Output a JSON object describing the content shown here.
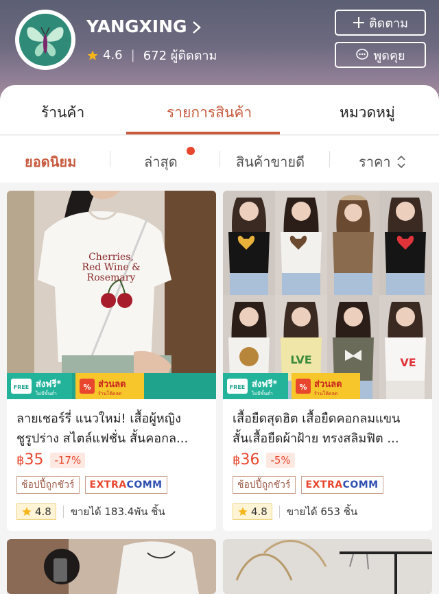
{
  "store": {
    "name": "YANGXING",
    "rating": "4.6",
    "followers": "672 ผู้ติดตาม",
    "follow_label": "ติดตาม",
    "chat_label": "พูดคุย"
  },
  "tabs": [
    {
      "label": "ร้านค้า"
    },
    {
      "label": "รายการสินค้า",
      "active": true
    },
    {
      "label": "หมวดหมู่"
    }
  ],
  "sort": [
    {
      "label": "ยอดนิยม",
      "active": true
    },
    {
      "label": "ล่าสุด"
    },
    {
      "label": "สินค้าขายดี"
    },
    {
      "label": "ราคา"
    }
  ],
  "banner": {
    "free_ship": "ส่งฟรี*",
    "free_ship_sub": "ไม่มีขั้นต่ำ",
    "discount": "ส่วนลด",
    "discount_sub": "ร้านโค้ดลด"
  },
  "products": [
    {
      "title_line1": "ลายเชอร์รี่ แนวใหม่! เสื้อผู้หญิง",
      "title_line2": "ชูรูปร่าง สไตล์แฟชั่น สั้นคอกล...",
      "currency": "฿",
      "price": "35",
      "discount": "-17%",
      "badge": "ช้อปปี้ถูกชัวร์",
      "extra1": "EXTRA",
      "extra2": "COMM",
      "rating": "4.8",
      "sold": "ขายได้ 183.4พัน ชิ้น",
      "shirt_text": [
        "Cherries,",
        "Red Wine &",
        "Rosemary"
      ]
    },
    {
      "title_line1": "เสื้อยืดสุดฮิต เสื้อยืดคอกลมแขน",
      "title_line2": "สั้นเสื้อยืดผ้าฝ้าย ทรงสลิมฟิต ...",
      "currency": "฿",
      "price": "36",
      "discount": "-5%",
      "badge": "ช้อปปี้ถูกชัวร์",
      "extra1": "EXTRA",
      "extra2": "COMM",
      "rating": "4.8",
      "sold": "ขายได้ 653 ชิ้น"
    }
  ],
  "colors": {
    "accent": "#c75a3e",
    "price": "#e8462d"
  }
}
